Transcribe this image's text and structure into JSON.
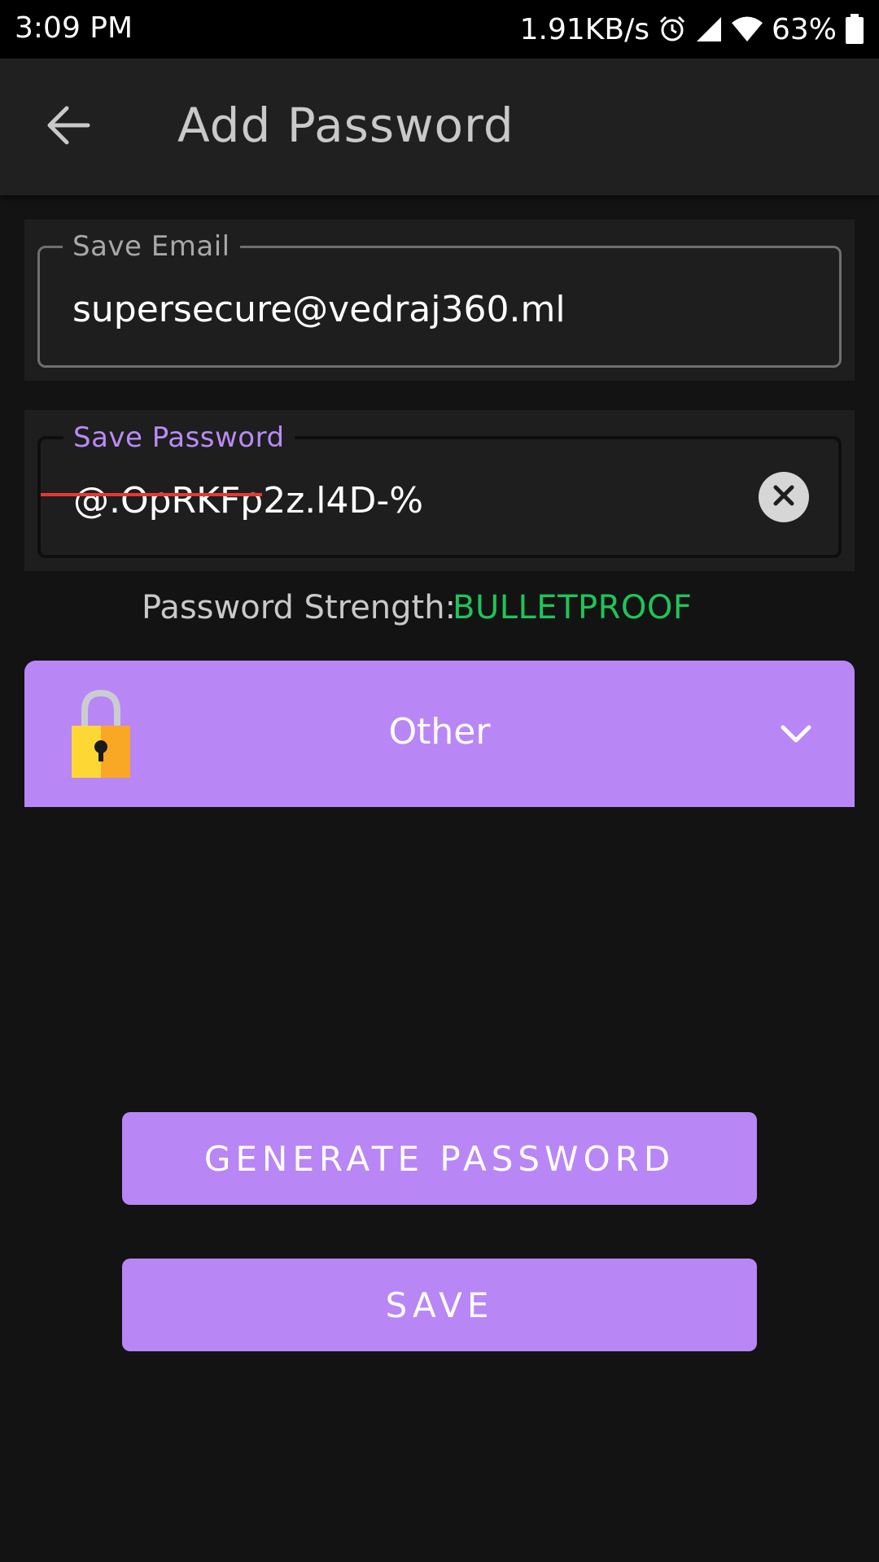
{
  "status_bar": {
    "time": "3:09 PM",
    "net_speed": "1.91KB/s",
    "battery": "63%",
    "icons": [
      "alarm-icon",
      "cell-signal-icon",
      "wifi-icon",
      "battery-icon"
    ]
  },
  "app_bar": {
    "title": "Add Password",
    "back_icon": "arrow-left-icon"
  },
  "email_field": {
    "label": "Save Email",
    "value": "supersecure@vedraj360.ml"
  },
  "password_field": {
    "label": "Save Password",
    "value": "@.OpRKFp2z.l4D-%",
    "clear_icon": "clear-icon"
  },
  "strength": {
    "label": "Password Strength:",
    "value": "BULLETPROOF"
  },
  "category": {
    "selected": "Other",
    "icon": "padlock-icon",
    "chevron_icon": "chevron-down-icon"
  },
  "buttons": {
    "generate": "GENERATE PASSWORD",
    "save": "SAVE"
  },
  "colors": {
    "accent": "#b986f6",
    "strength_good": "#1fc45a",
    "background": "#131313",
    "surface": "#202020"
  }
}
